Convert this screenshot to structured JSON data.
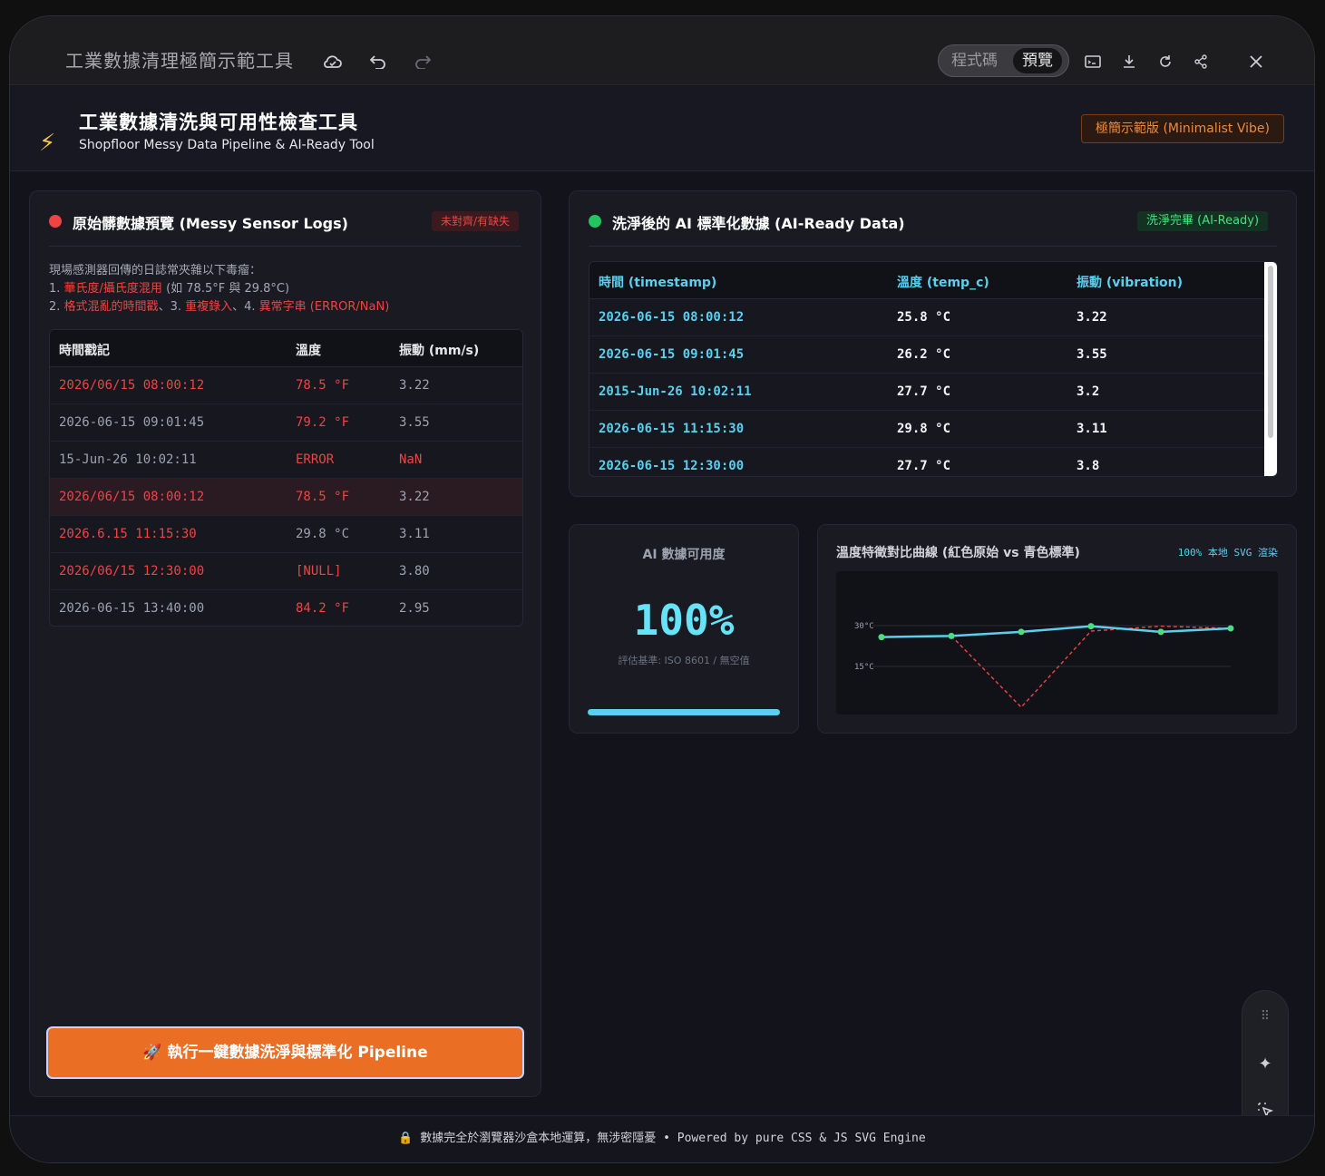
{
  "window": {
    "app_title": "工業數據清理極簡示範工具",
    "toggle_code": "程式碼",
    "toggle_preview": "預覽"
  },
  "header": {
    "title": "工業數據清洗與可用性檢查工具",
    "subtitle": "Shopfloor Messy Data Pipeline & AI-Ready Tool",
    "badge": "極簡示範版 (Minimalist Vibe)"
  },
  "raw_panel": {
    "title": "原始髒數據預覽 (Messy Sensor Logs)",
    "tag": "未對齊/有缺失",
    "desc_intro": "現場感測器回傳的日誌常夾雜以下毒瘤：",
    "desc_line1_prefix": "1. ",
    "desc_line1_hl": "華氏度/攝氏度混用",
    "desc_line1_rest": " (如 78.5°F 與 29.8°C)",
    "desc_line2_prefix": "2. ",
    "desc_line2_hl1": "格式混亂的時間戳",
    "desc_line2_mid": "、3. ",
    "desc_line2_hl2": "重複錄入",
    "desc_line2_mid2": "、4. ",
    "desc_line2_hl3": "異常字串 (ERROR/NaN)",
    "columns": [
      "時間戳記",
      "溫度",
      "振動 (mm/s)"
    ],
    "rows": [
      {
        "time": "2026/06/15 08:00:12",
        "temp": "78.5 °F",
        "vib": "3.22"
      },
      {
        "time": "2026-06-15 09:01:45",
        "temp": "79.2 °F",
        "vib": "3.55"
      },
      {
        "time": "15-Jun-26 10:02:11",
        "temp": "ERROR",
        "vib": "NaN"
      },
      {
        "time": "2026/06/15 08:00:12",
        "temp": "78.5 °F",
        "vib": "3.22"
      },
      {
        "time": "2026.6.15 11:15:30",
        "temp": "29.8 °C",
        "vib": "3.11"
      },
      {
        "time": "2026/06/15 12:30:00",
        "temp": "[NULL]",
        "vib": "3.80"
      },
      {
        "time": "2026-06-15 13:40:00",
        "temp": "84.2 °F",
        "vib": "2.95"
      }
    ],
    "run_button": "🚀 執行一鍵數據洗淨與標準化 Pipeline"
  },
  "clean_panel": {
    "title": "洗淨後的 AI 標準化數據 (AI-Ready Data)",
    "tag": "洗淨完畢 (AI-Ready)",
    "columns": [
      "時間 (timestamp)",
      "溫度 (temp_c)",
      "振動 (vibration)"
    ],
    "rows": [
      {
        "time": "2026-06-15 08:00:12",
        "temp": "25.8 °C",
        "vib": "3.22"
      },
      {
        "time": "2026-06-15 09:01:45",
        "temp": "26.2 °C",
        "vib": "3.55"
      },
      {
        "time": "2015-Jun-26 10:02:11",
        "temp": "27.7 °C",
        "vib": "3.2"
      },
      {
        "time": "2026-06-15 11:15:30",
        "temp": "29.8 °C",
        "vib": "3.11"
      },
      {
        "time": "2026-06-15 12:30:00",
        "temp": "27.7 °C",
        "vib": "3.8"
      }
    ]
  },
  "kpi": {
    "label": "AI 數據可用度",
    "value": "100%",
    "sub": "評估基準: ISO 8601 / 無空值",
    "progress": 1.0
  },
  "chart_data": {
    "type": "line",
    "title": "溫度特徵對比曲線 (紅色原始 vs 青色標準)",
    "tag": "100% 本地 SVG 渲染",
    "y_ticks": [
      "30°C",
      "15°C"
    ],
    "ylim": [
      0,
      40
    ],
    "series": [
      {
        "values": [
          25.8,
          26.2,
          27.7,
          29.8,
          27.7,
          29.0
        ],
        "color": "#5ad0ee",
        "style": "solid"
      },
      {
        "values": [
          25.8,
          26.2,
          0,
          28.0,
          29.8,
          29.0
        ],
        "color": "#ef4444",
        "style": "dashed"
      }
    ]
  },
  "footer": {
    "text": "🔒 數據完全於瀏覽器沙盒本地運算，無涉密隱憂 • Powered by pure CSS & JS SVG Engine"
  },
  "icons": [
    "cloud-icon",
    "undo-icon",
    "redo-icon",
    "terminal-icon",
    "download-icon",
    "refresh-icon",
    "share-icon",
    "close-icon",
    "grip-icon",
    "sparkle-icon",
    "select-icon"
  ]
}
